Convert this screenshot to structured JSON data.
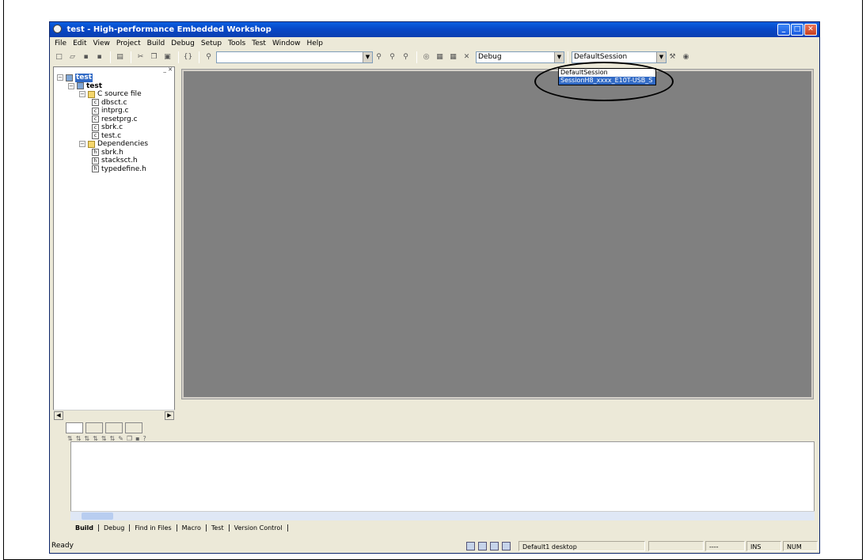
{
  "window": {
    "title": "test - High-performance Embedded Workshop"
  },
  "menu": [
    "File",
    "Edit",
    "View",
    "Project",
    "Build",
    "Debug",
    "Setup",
    "Tools",
    "Test",
    "Window",
    "Help"
  ],
  "toolbar": {
    "build_config": "Debug",
    "session": "DefaultSession"
  },
  "session_dropdown": {
    "options": [
      "DefaultSession",
      "SessionH8_xxxx_E10T-USB_S"
    ],
    "selected_index": 1
  },
  "workspace": {
    "root": "test",
    "project": "test",
    "folders": [
      {
        "name": "C source file",
        "files": [
          "dbsct.c",
          "intprg.c",
          "resetprg.c",
          "sbrk.c",
          "test.c"
        ]
      },
      {
        "name": "Dependencies",
        "files": [
          "sbrk.h",
          "stacksct.h",
          "typedefine.h"
        ]
      }
    ]
  },
  "output": {
    "tabs": [
      "Build",
      "Debug",
      "Find in Files",
      "Macro",
      "Test",
      "Version Control"
    ],
    "active_tab": "Build"
  },
  "status": {
    "text": "Ready",
    "desktop": "Default1 desktop",
    "position": "----",
    "ins": "INS",
    "num": "NUM"
  },
  "colors": {
    "titlebar": "#0a5fe0",
    "mdi_background": "#808080",
    "selection": "#316ac5"
  }
}
